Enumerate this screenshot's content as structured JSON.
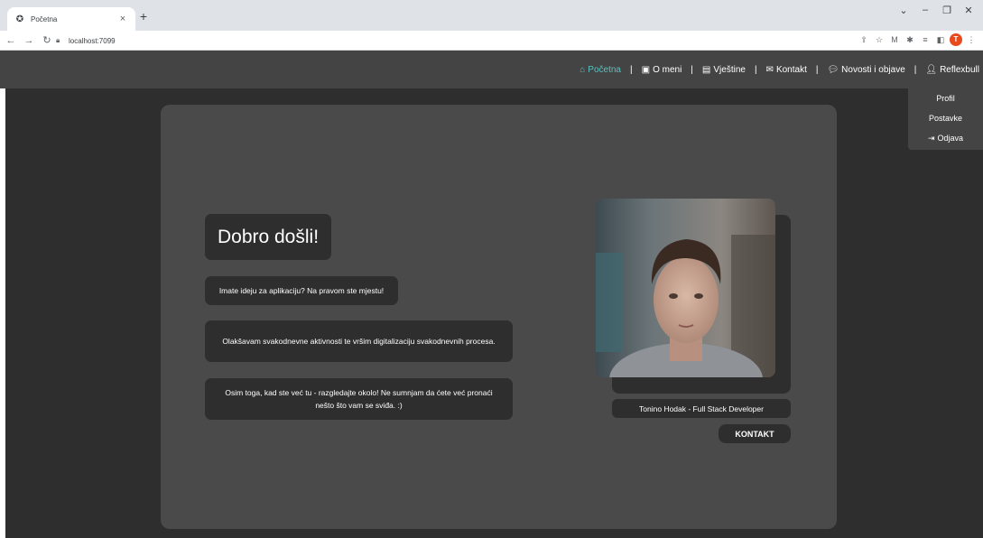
{
  "browser": {
    "tab_title": "Početna",
    "url": "localhost:7099",
    "profile_initial": "T"
  },
  "nav": {
    "items": [
      {
        "label": "Početna",
        "icon": "home-icon"
      },
      {
        "label": "O meni",
        "icon": "id-card-icon"
      },
      {
        "label": "Vještine",
        "icon": "notebook-icon"
      },
      {
        "label": "Kontakt",
        "icon": "envelope-icon"
      },
      {
        "label": "Novosti i objave",
        "icon": "comments-icon"
      },
      {
        "label": "Reflexbull",
        "icon": "user-icon"
      }
    ],
    "separator": "|"
  },
  "dropdown": {
    "items": [
      "Profil",
      "Postavke",
      "Odjava"
    ]
  },
  "hero": {
    "heading": "Dobro došli!",
    "bubbles": [
      "Imate ideju za aplikaciju? Na pravom ste mjestu!",
      "Olakšavam svakodnevne aktivnosti te vršim digitalizaciju svakodnevnih procesa.",
      "Osim toga, kad ste već tu - razgledajte okolo! Ne sumnjam da ćete već pronaći nešto što vam se sviđa. :)"
    ],
    "caption": "Tonino Hodak - Full Stack Developer",
    "button": "KONTAKT"
  },
  "colors": {
    "accent": "#5bc0be",
    "navbar": "#444444",
    "card": "#4a4a4a",
    "bubble": "#2e2e2e"
  }
}
